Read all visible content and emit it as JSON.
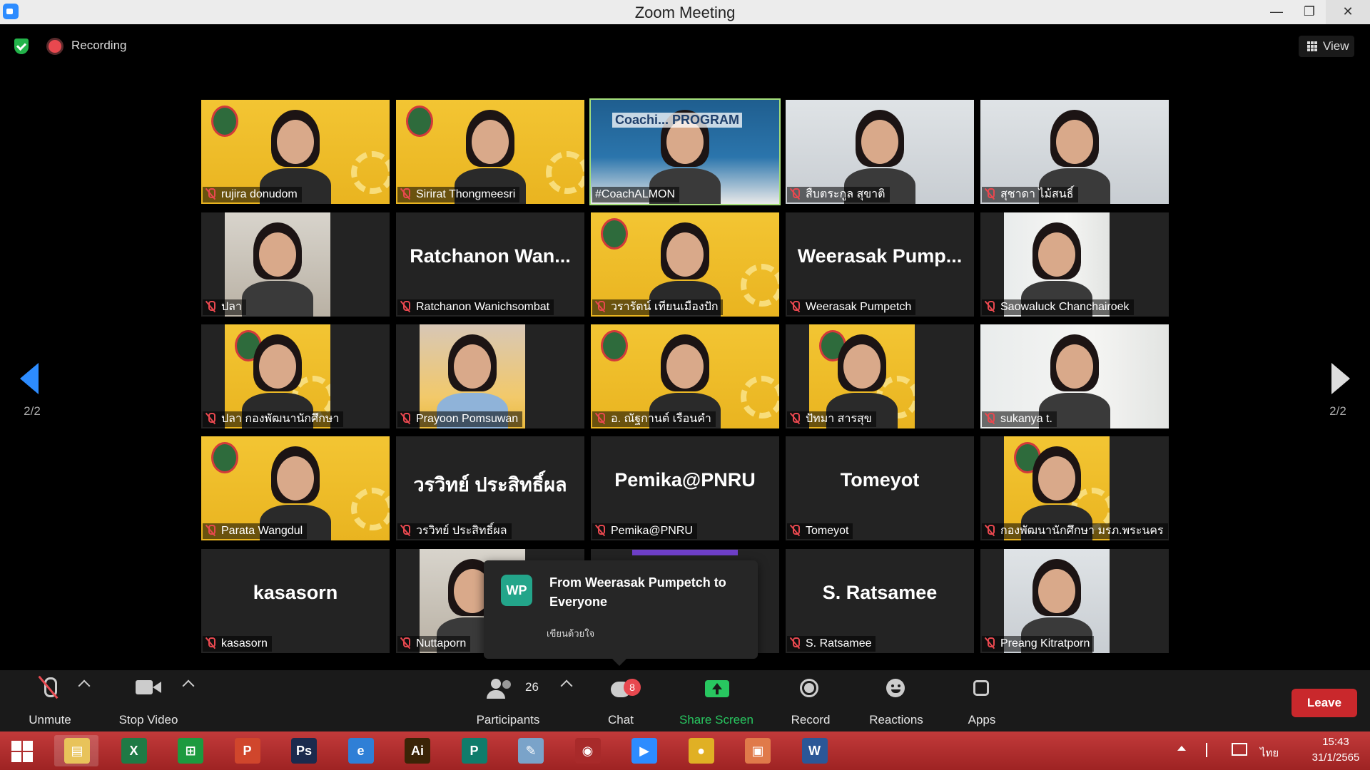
{
  "window": {
    "title": "Zoom Meeting",
    "minimize": "—",
    "restore": "❐",
    "close": "✕"
  },
  "topbar": {
    "recording_label": "Recording",
    "view_label": "View"
  },
  "pagination": {
    "left": "2/2",
    "right": "2/2"
  },
  "tiles": [
    {
      "name": "rujira donudom",
      "bg": "poster",
      "muted": true,
      "active": false
    },
    {
      "name": "Sirirat Thongmeesri",
      "bg": "poster",
      "muted": true,
      "active": false
    },
    {
      "name": "#CoachALMON",
      "bg": "coach",
      "muted": false,
      "active": true,
      "overlay": "Coachi... PROGRAM"
    },
    {
      "name": "สืบตระกูล สุขาติ",
      "bg": "office",
      "muted": true,
      "active": false
    },
    {
      "name": "สุชาดา ไม้สนธิ์",
      "bg": "office",
      "muted": true,
      "active": false
    },
    {
      "name": "ปลา",
      "bg": "room",
      "muted": true,
      "active": false
    },
    {
      "name": "Ratchanon Wanichsombat",
      "display": "Ratchanon Wan...",
      "bg": "none",
      "muted": true,
      "active": false
    },
    {
      "name": "วรารัตน์ เทียนเมืองปัก",
      "bg": "poster",
      "muted": true,
      "active": false
    },
    {
      "name": "Weerasak Pumpetch",
      "display": "Weerasak Pump...",
      "bg": "none",
      "muted": true,
      "active": false
    },
    {
      "name": "Saowaluck Chanchairoek",
      "bg": "plants",
      "muted": true,
      "active": false
    },
    {
      "name": "ปลา กองพัฒนานักศึกษา",
      "bg": "poster",
      "muted": true,
      "active": false
    },
    {
      "name": "Prayoon Pomsuwan",
      "bg": "stage",
      "muted": true,
      "active": false
    },
    {
      "name": "อ. ณัฐกานต์ เรือนคำ",
      "bg": "poster",
      "muted": true,
      "active": false
    },
    {
      "name": "ปัทมา สารสุข",
      "bg": "poster",
      "muted": true,
      "active": false
    },
    {
      "name": "sukanya t.",
      "bg": "plants",
      "muted": true,
      "active": false
    },
    {
      "name": "Parata Wangdul",
      "bg": "poster",
      "muted": true,
      "active": false
    },
    {
      "name": "วรวิทย์ ประสิทธิ์ผล",
      "display": "วรวิทย์ ประสิทธิ์ผล",
      "bg": "none",
      "muted": true,
      "active": false
    },
    {
      "name": "Pemika@PNRU",
      "display": "Pemika@PNRU",
      "bg": "none",
      "muted": true,
      "active": false
    },
    {
      "name": "Tomeyot",
      "display": "Tomeyot",
      "bg": "none",
      "muted": true,
      "active": false
    },
    {
      "name": "กองพัฒนานักศึกษา มรภ.พระนคร",
      "bg": "poster",
      "muted": true,
      "active": false
    },
    {
      "name": "kasasorn",
      "display": "kasasorn",
      "bg": "none",
      "muted": true,
      "active": false
    },
    {
      "name": "Nuttaporn",
      "bg": "room",
      "muted": true,
      "active": false
    },
    {
      "name": "",
      "bg": "none",
      "muted": false,
      "active": false
    },
    {
      "name": "S. Ratsamee",
      "display": "S. Ratsamee",
      "bg": "none",
      "muted": true,
      "active": false
    },
    {
      "name": "Preang Kitratporn",
      "bg": "office",
      "muted": true,
      "active": false
    }
  ],
  "chat_popup": {
    "initials": "WP",
    "from": "From Weerasak Pumpetch to Everyone",
    "message": "เขียนด้วยใจ"
  },
  "toolbar": {
    "unmute": "Unmute",
    "stop_video": "Stop Video",
    "participants": "Participants",
    "participants_count": "26",
    "chat": "Chat",
    "chat_badge": "8",
    "share_screen": "Share Screen",
    "record": "Record",
    "reactions": "Reactions",
    "apps": "Apps",
    "leave": "Leave"
  },
  "taskbar": {
    "apps": [
      {
        "name": "file-explorer",
        "glyph": "▤",
        "color": "#e8c35a"
      },
      {
        "name": "excel",
        "glyph": "X",
        "color": "#1f7a45"
      },
      {
        "name": "store",
        "glyph": "⊞",
        "color": "#1c9a3f"
      },
      {
        "name": "powerpoint",
        "glyph": "P",
        "color": "#d0462c"
      },
      {
        "name": "photoshop",
        "glyph": "Ps",
        "color": "#1b2a4d"
      },
      {
        "name": "internet-explorer",
        "glyph": "e",
        "color": "#2f7fd6"
      },
      {
        "name": "illustrator",
        "glyph": "Ai",
        "color": "#3a2407"
      },
      {
        "name": "publisher",
        "glyph": "P",
        "color": "#107c6b"
      },
      {
        "name": "notes",
        "glyph": "✎",
        "color": "#7aa3c9"
      },
      {
        "name": "photoscape",
        "glyph": "◉",
        "color": "#a82a2a"
      },
      {
        "name": "zoom",
        "glyph": "▶",
        "color": "#2d8cff"
      },
      {
        "name": "chrome",
        "glyph": "●",
        "color": "#e0b024"
      },
      {
        "name": "photos",
        "glyph": "▣",
        "color": "#e07a4a"
      },
      {
        "name": "word",
        "glyph": "W",
        "color": "#2b5797"
      }
    ],
    "lang": "ไทย",
    "time": "15:43",
    "date": "31/1/2565"
  }
}
